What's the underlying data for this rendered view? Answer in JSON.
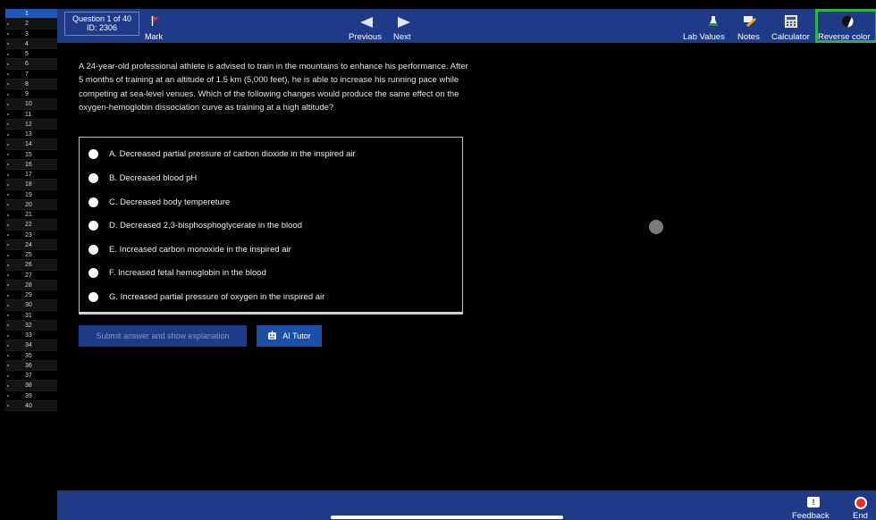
{
  "sidebar": {
    "questions": [
      "1",
      "2",
      "3",
      "4",
      "5",
      "6",
      "7",
      "8",
      "9",
      "10",
      "11",
      "12",
      "13",
      "14",
      "15",
      "16",
      "17",
      "18",
      "19",
      "20",
      "21",
      "22",
      "23",
      "24",
      "25",
      "26",
      "27",
      "28",
      "29",
      "30",
      "31",
      "32",
      "33",
      "34",
      "35",
      "36",
      "37",
      "38",
      "39",
      "40"
    ],
    "active_index": 0
  },
  "header": {
    "question_counter": "Question 1 of 40",
    "question_id": "ID: 2306",
    "mark_label": "Mark",
    "previous_label": "Previous",
    "next_label": "Next",
    "lab_values_label": "Lab Values",
    "notes_label": "Notes",
    "calculator_label": "Calculator",
    "reverse_color_label": "Reverse color"
  },
  "question": {
    "stem": "A 24-year-old professional athlete is advised to train in the mountains to enhance his performance. After 5 months of training at an altitude of 1.5 km (5,000 feet), he is able to increase his running pace while competing at sea-level venues. Which of the following changes would produce the same effect on the oxygen-hemoglobin dissociation curve as training at a high altitude?",
    "choices": [
      "A. Decreased partial pressure of carbon dioxide in the inspired air",
      "B. Decreased blood pH",
      "C. Decreased body tempereture",
      "D. Decreased 2,3-bisphosphoglycerate in the blood",
      "E. Increased carbon monoxide in the inspired air",
      "F. Increased fetal hemoglobin in the blood",
      "G. Increased partial pressure of oxygen in the inspired air"
    ]
  },
  "actions": {
    "submit_label": "Submit answer and show explanation",
    "ai_tutor_label": "AI Tutor"
  },
  "footer": {
    "feedback_label": "Feedback",
    "end_label": "End"
  },
  "colors": {
    "bar_blue": "#1f3b87",
    "active_blue": "#1c57b8",
    "highlight_green": "#2fb24a",
    "end_red": "#ee2a2a"
  }
}
